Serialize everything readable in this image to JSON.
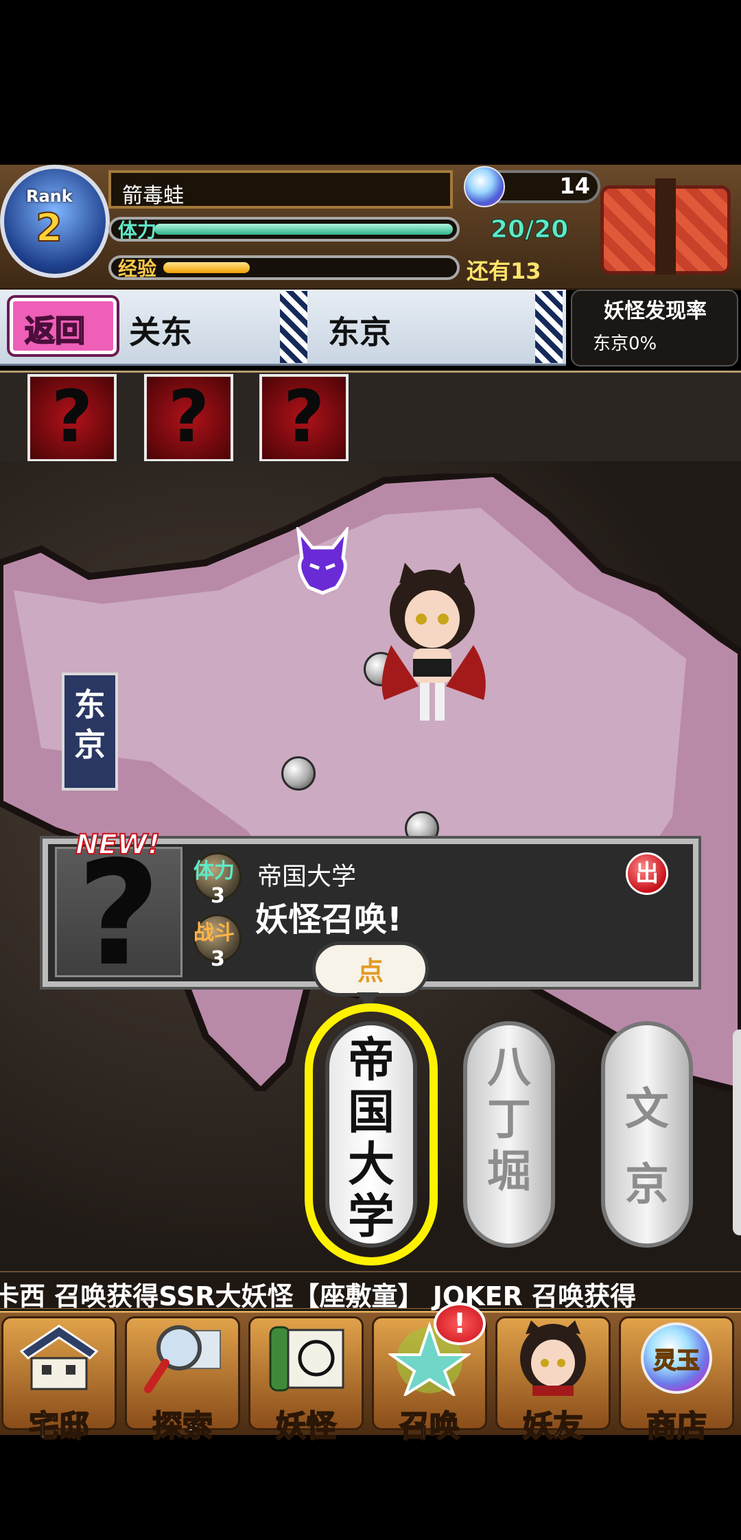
{
  "hud": {
    "rank_label": "Rank",
    "rank_value": "2",
    "player_name": "箭毒蛙",
    "gems": "14",
    "stamina_label": "体力",
    "stamina_text": "20/20",
    "stamina_fraction": 1.0,
    "exp_label": "经验",
    "exp_remaining": "还有13",
    "exp_fraction": 0.3
  },
  "location_bar": {
    "back_label": "返回",
    "region": "关东",
    "city": "东京",
    "discovery_title": "妖怪发现率",
    "discovery_rate": "东京0%"
  },
  "slots": [
    "?",
    "?",
    "?"
  ],
  "map": {
    "city_sign": "东\n京"
  },
  "info_panel": {
    "new_badge": "NEW!",
    "portrait": "?",
    "stat1_label": "体力",
    "stat1_value": "3",
    "stat2_label": "战斗",
    "stat2_value": "3",
    "location_name": "帝国大学",
    "action_text": "妖怪召唤!",
    "exit_icon": "出"
  },
  "tap_hint": "点",
  "locations": [
    {
      "label": "帝\n国\n大\n学",
      "selected": true
    },
    {
      "label": "八\n丁\n堀",
      "selected": false
    },
    {
      "label": "文\n京",
      "selected": false
    }
  ],
  "ticker": "卡西 召唤获得SSR大妖怪【座敷童】    JOKER 召唤获得",
  "nav": [
    {
      "label": "宅邸",
      "icon": "house-icon"
    },
    {
      "label": "探索",
      "icon": "magnifier-map-icon"
    },
    {
      "label": "妖怪",
      "icon": "scroll-icon"
    },
    {
      "label": "召唤",
      "icon": "pentagram-icon",
      "badge": "!"
    },
    {
      "label": "妖友",
      "icon": "friend-girl-icon"
    },
    {
      "label": "商店",
      "icon": "spirit-orb-icon",
      "orb_text": "灵玉"
    }
  ],
  "colors": {
    "stamina": "#5fe9c7",
    "exp": "#f2a100",
    "selected_ring": "#fff200",
    "back_button": "#ee5fb8"
  }
}
